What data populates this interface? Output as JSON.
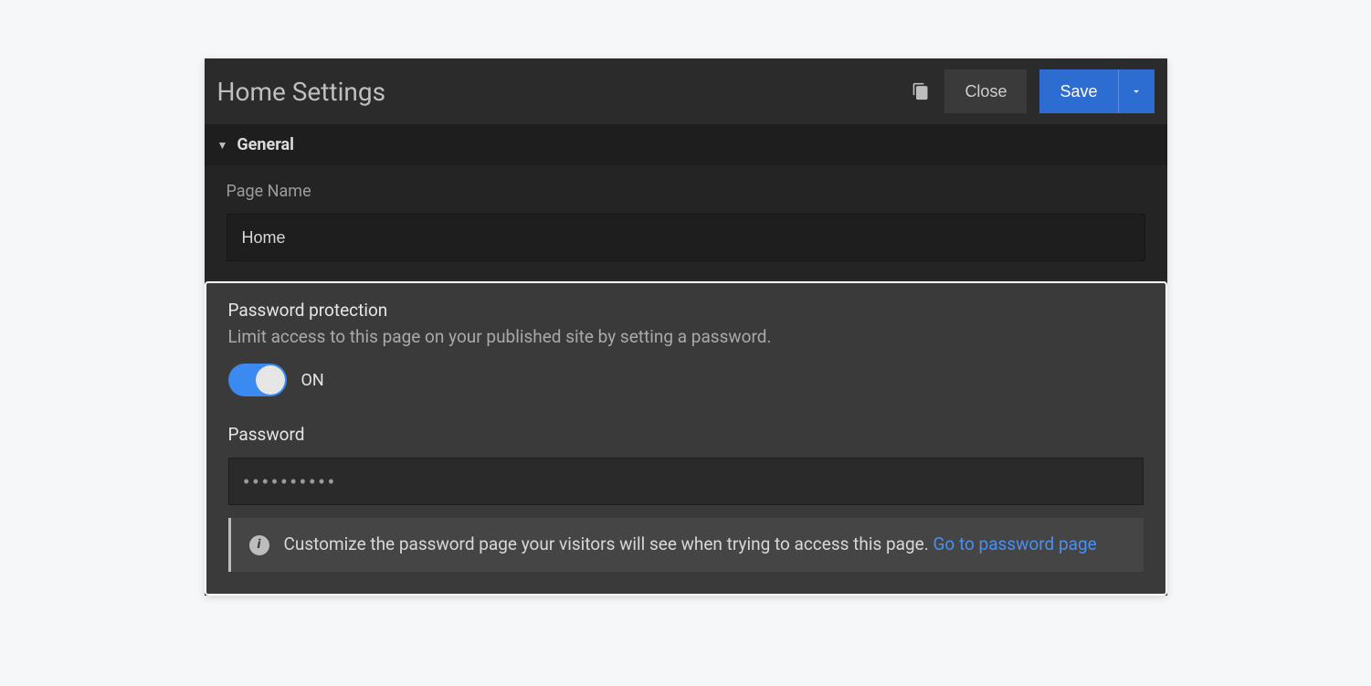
{
  "header": {
    "title": "Home Settings",
    "close_label": "Close",
    "save_label": "Save"
  },
  "section_general": {
    "title": "General",
    "page_name_label": "Page Name",
    "page_name_value": "Home"
  },
  "password_protection": {
    "title": "Password protection",
    "description": "Limit access to this page on your published site by setting a password.",
    "toggle_state": "ON",
    "password_label": "Password",
    "password_value": "••••••••••",
    "info_text": "Customize the password page your visitors will see when trying to access this page.",
    "info_link_text": "Go to password page"
  }
}
